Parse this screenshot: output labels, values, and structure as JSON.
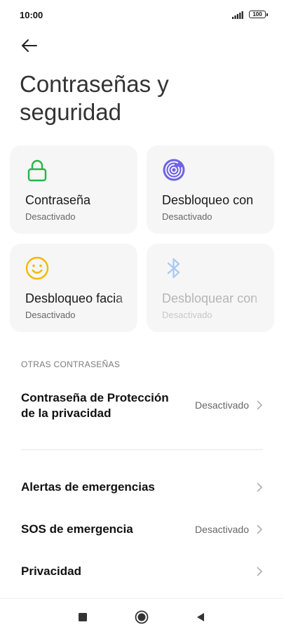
{
  "status": {
    "time": "10:00",
    "battery": "100"
  },
  "title": "Contraseñas y seguridad",
  "tiles": [
    {
      "label": "Contraseña",
      "status": "Desactivado",
      "icon": "lock-icon",
      "color": "#25b54a"
    },
    {
      "label": "Desbloqueo con",
      "status": "Desactivado",
      "icon": "fingerprint-icon",
      "color": "#6f63e6"
    },
    {
      "label": "Desbloqueo facia",
      "status": "Desactivado",
      "icon": "face-icon",
      "color": "#f5b800"
    },
    {
      "label": "Desbloquear con",
      "status": "Desactivado",
      "icon": "bluetooth-icon",
      "color": "#a8c8f0"
    }
  ],
  "section_header": "OTRAS CONTRASEÑAS",
  "rows": [
    {
      "title_line1": "Contraseña de Protección",
      "title_line2": "de la privacidad",
      "value": "Desactivado"
    },
    {
      "title": "Alertas de emergencias"
    },
    {
      "title": "SOS de emergencia",
      "value": "Desactivado"
    },
    {
      "title": "Privacidad"
    }
  ],
  "nav": {
    "icons": [
      "recents-square-icon",
      "home-circle-icon",
      "back-triangle-icon"
    ]
  }
}
